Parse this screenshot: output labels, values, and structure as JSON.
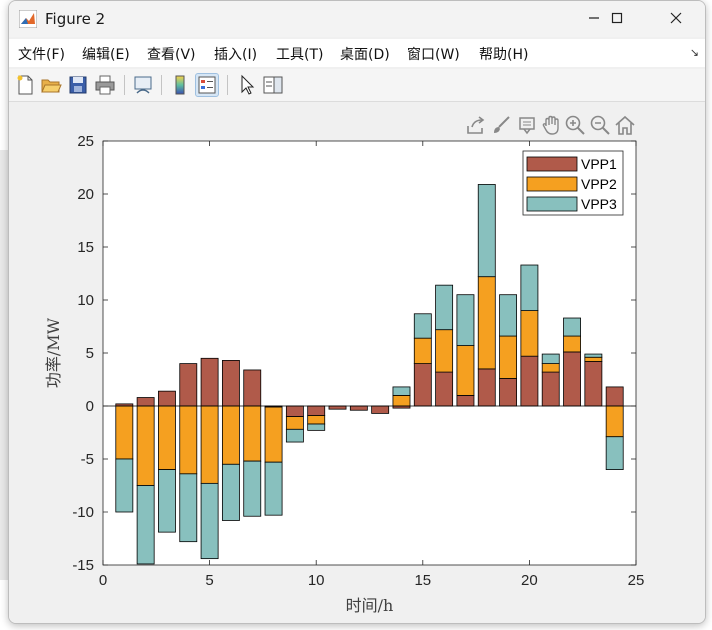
{
  "window": {
    "title": "Figure 2"
  },
  "menu": {
    "items": [
      "文件(F)",
      "编辑(E)",
      "查看(V)",
      "插入(I)",
      "工具(T)",
      "桌面(D)",
      "窗口(W)",
      "帮助(H)"
    ]
  },
  "toolbar": {
    "buttons": [
      "new-figure-icon",
      "open-file-icon",
      "save-icon",
      "print-icon",
      "link-plot-icon",
      "colorbar-icon",
      "legend-icon",
      "pointer-icon",
      "property-inspector-icon"
    ]
  },
  "axes_toolbar": [
    "export-icon",
    "brush-icon",
    "datatip-icon",
    "pan-icon",
    "zoom-in-icon",
    "zoom-out-icon",
    "home-icon"
  ],
  "colors": {
    "vpp1": "#b05a4a",
    "vpp2": "#f5a020",
    "vpp3": "#88c0be"
  },
  "chart_data": {
    "type": "bar",
    "stacked": true,
    "title": "",
    "xlabel": "时间/h",
    "ylabel": "功率/MW",
    "xlim": [
      0,
      25
    ],
    "ylim": [
      -15,
      25
    ],
    "xticks": [
      0,
      5,
      10,
      15,
      20,
      25
    ],
    "yticks": [
      -15,
      -10,
      -5,
      0,
      5,
      10,
      15,
      20,
      25
    ],
    "grid": false,
    "legend_position": "top-right",
    "categories": [
      1,
      2,
      3,
      4,
      5,
      6,
      7,
      8,
      9,
      10,
      11,
      12,
      13,
      14,
      15,
      16,
      17,
      18,
      19,
      20,
      21,
      22,
      23,
      24
    ],
    "series": [
      {
        "name": "VPP1",
        "color": "#b05a4a",
        "values": [
          0.2,
          0.8,
          1.4,
          4.0,
          4.5,
          4.3,
          3.4,
          -0.1,
          -1.0,
          -0.9,
          -0.3,
          -0.4,
          -0.7,
          -0.2,
          4.0,
          3.2,
          1.0,
          3.5,
          2.6,
          4.7,
          3.2,
          5.1,
          4.2,
          1.8
        ]
      },
      {
        "name": "VPP2",
        "color": "#f5a020",
        "values": [
          -5.0,
          -7.5,
          -6.0,
          -6.4,
          -7.3,
          -5.5,
          -5.2,
          -5.2,
          -1.2,
          -0.8,
          0,
          0,
          0,
          1.0,
          2.4,
          4.0,
          4.7,
          8.7,
          4.0,
          4.3,
          0.8,
          1.5,
          0.4,
          -2.9
        ]
      },
      {
        "name": "VPP3",
        "color": "#88c0be",
        "values": [
          -5.0,
          -7.4,
          -5.9,
          -6.4,
          -7.1,
          -5.3,
          -5.2,
          -5.0,
          -1.2,
          -0.6,
          0,
          0,
          0,
          0.8,
          2.3,
          4.2,
          4.8,
          8.7,
          3.9,
          4.3,
          0.9,
          1.7,
          0.3,
          -3.1
        ]
      }
    ]
  }
}
